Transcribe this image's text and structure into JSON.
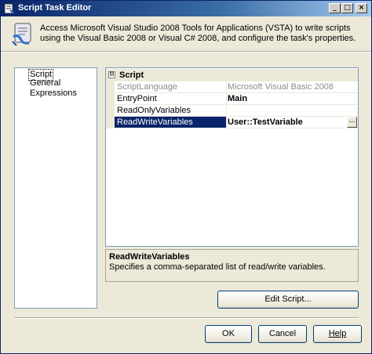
{
  "window": {
    "title": "Script Task Editor",
    "buttons": {
      "minimize": "_",
      "maximize": "□",
      "close": "×"
    }
  },
  "header": {
    "icon": "script-task-icon",
    "description": "Access Microsoft Visual Studio 2008 Tools for Applications (VSTA) to write scripts using the Visual Basic 2008 or Visual C# 2008, and configure the task's properties."
  },
  "nav": {
    "items": [
      {
        "label": "Script",
        "selected": true
      },
      {
        "label": "General",
        "selected": false
      },
      {
        "label": "Expressions",
        "selected": false
      }
    ]
  },
  "grid": {
    "category": {
      "expander": "⊟",
      "label": "Script"
    },
    "rows": [
      {
        "name": "ScriptLanguage",
        "value": "Microsoft Visual Basic 2008",
        "state": "disabled"
      },
      {
        "name": "EntryPoint",
        "value": "Main",
        "state": "bold"
      },
      {
        "name": "ReadOnlyVariables",
        "value": "",
        "state": "normal"
      },
      {
        "name": "ReadWriteVariables",
        "value": "User::TestVariable",
        "state": "selected"
      }
    ],
    "ellipsis_label": "..."
  },
  "description": {
    "title": "ReadWriteVariables",
    "text": "Specifies a comma-separated list of read/write variables."
  },
  "buttons": {
    "edit_script": "Edit Script...",
    "ok": "OK",
    "cancel": "Cancel",
    "help": "Help"
  },
  "colors": {
    "titlebar": "#0a246a",
    "selection": "#0a246a",
    "face": "#ece9d8",
    "border": "#7f9db9"
  }
}
